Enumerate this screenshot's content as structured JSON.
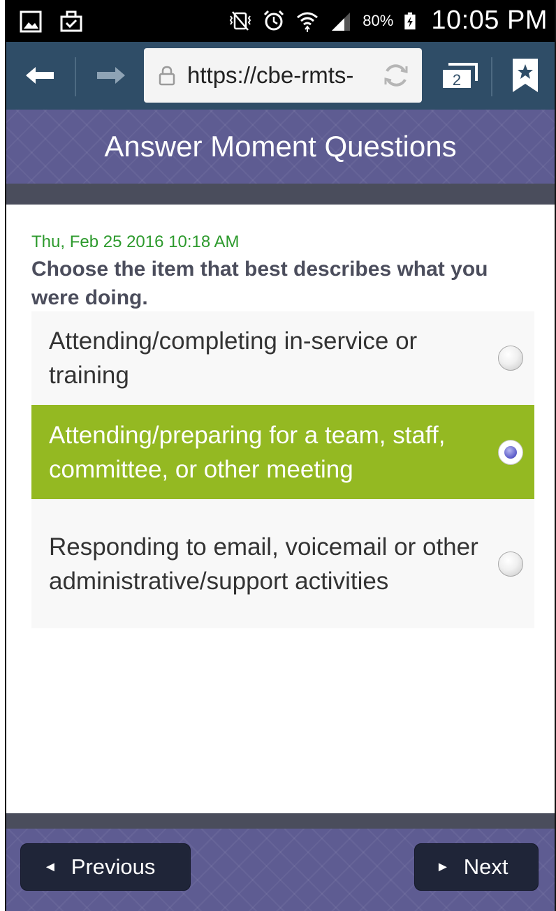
{
  "status_bar": {
    "battery_percent": "80%",
    "time": "10:05 PM",
    "icons": [
      "gallery-icon",
      "briefcase-icon",
      "vibrate-mute-icon",
      "alarm-icon",
      "wifi-icon",
      "signal-icon",
      "battery-charging-icon"
    ]
  },
  "browser": {
    "url": "https://cbe-rmts-",
    "tab_count": "2",
    "icons": [
      "back-arrow-icon",
      "forward-arrow-icon",
      "lock-icon",
      "reload-icon",
      "tabs-icon",
      "bookmark-icon"
    ]
  },
  "header": {
    "title": "Answer Moment Questions"
  },
  "question": {
    "timestamp": "Thu, Feb 25 2016 10:18 AM",
    "prompt": "Choose the item that best describes what you were doing."
  },
  "options": [
    {
      "label": "Attending/completing in-service or training",
      "selected": false
    },
    {
      "label": "Attending/preparing for a team, staff, committee, or other meeting",
      "selected": true
    },
    {
      "label": "Responding to email, voicemail or other administrative/support activities",
      "selected": false
    }
  ],
  "footer": {
    "previous_label": "Previous",
    "next_label": "Next"
  },
  "colors": {
    "status_bar": "#000000",
    "toolbar": "#2f4d67",
    "header": "#5e5c92",
    "strip": "#4a4d5c",
    "timestamp": "#2d9a2d",
    "selected_option": "#94b922",
    "nav_button": "#1f2538"
  }
}
